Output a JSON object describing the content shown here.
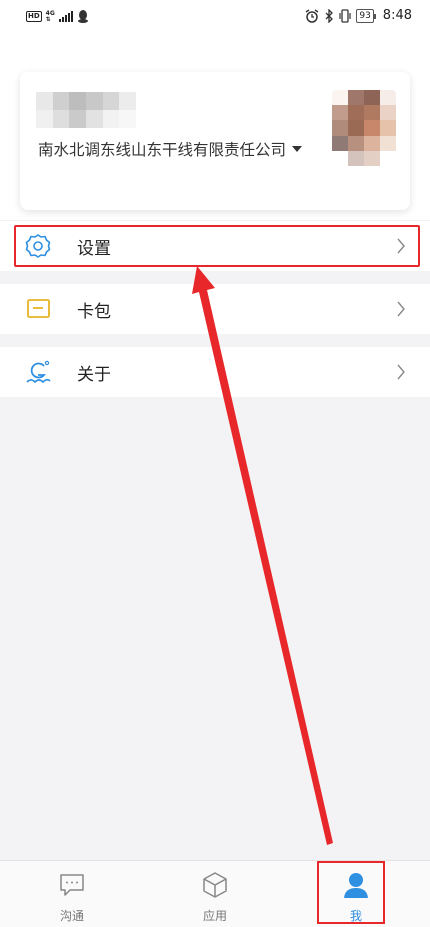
{
  "status_bar": {
    "hd": "HD",
    "network_top": "4G",
    "network_bottom": "⇅",
    "battery": "93",
    "time": "8:48"
  },
  "profile": {
    "company": "南水北调东线山东干线有限责任公司"
  },
  "menu": [
    {
      "label": "设置",
      "icon": "gear-icon"
    },
    {
      "label": "卡包",
      "icon": "card-wallet-icon"
    },
    {
      "label": "关于",
      "icon": "about-icon"
    }
  ],
  "bottom_nav": [
    {
      "label": "沟通",
      "icon": "chat-icon",
      "active": false
    },
    {
      "label": "应用",
      "icon": "cube-icon",
      "active": false
    },
    {
      "label": "我",
      "icon": "person-icon",
      "active": true
    }
  ],
  "colors": {
    "accent": "#2f8fe0",
    "annotation_red": "#e8272a",
    "card_icon": "#e6b422"
  }
}
